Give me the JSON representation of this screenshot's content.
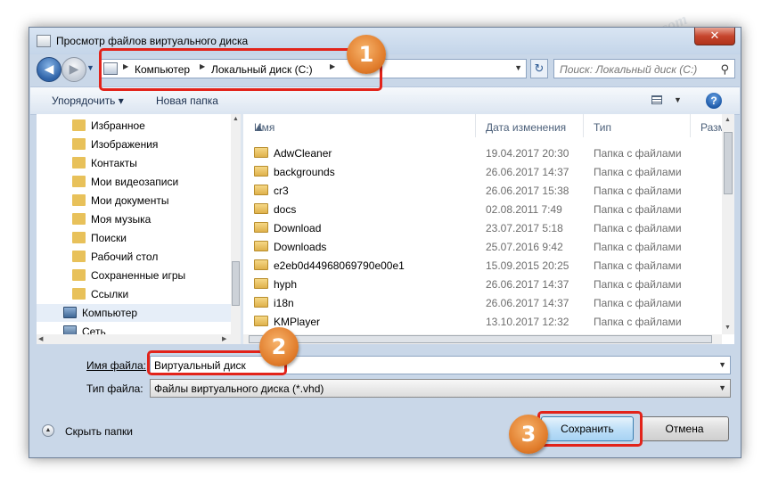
{
  "window": {
    "title": "Просмотр файлов виртуального диска",
    "close_label": "✕"
  },
  "nav": {
    "back_icon": "arrow-left-icon",
    "forward_icon": "arrow-right-icon",
    "breadcrumb": [
      "Компьютер",
      "Локальный диск (C:)"
    ],
    "search_placeholder": "Поиск: Локальный диск (C:)"
  },
  "toolbar": {
    "organize_label": "Упорядочить ▾",
    "new_folder_label": "Новая папка",
    "help_label": "?"
  },
  "sidebar": {
    "items": [
      {
        "label": "Избранное"
      },
      {
        "label": "Изображения"
      },
      {
        "label": "Контакты"
      },
      {
        "label": "Мои видеозаписи"
      },
      {
        "label": "Мои документы"
      },
      {
        "label": "Моя музыка"
      },
      {
        "label": "Поиски"
      },
      {
        "label": "Рабочий стол"
      },
      {
        "label": "Сохраненные игры"
      },
      {
        "label": "Ссылки"
      },
      {
        "label": "Компьютер"
      },
      {
        "label": "Сеть"
      }
    ]
  },
  "files": {
    "columns": [
      "Имя",
      "Дата изменения",
      "Тип",
      "Разм"
    ],
    "rows": [
      {
        "name": "AdwCleaner",
        "date": "19.04.2017 20:30",
        "type": "Папка с файлами"
      },
      {
        "name": "backgrounds",
        "date": "26.06.2017 14:37",
        "type": "Папка с файлами"
      },
      {
        "name": "cr3",
        "date": "26.06.2017 15:38",
        "type": "Папка с файлами"
      },
      {
        "name": "docs",
        "date": "02.08.2011 7:49",
        "type": "Папка с файлами"
      },
      {
        "name": "Download",
        "date": "23.07.2017 5:18",
        "type": "Папка с файлами"
      },
      {
        "name": "Downloads",
        "date": "25.07.2016 9:42",
        "type": "Папка с файлами"
      },
      {
        "name": "e2eb0d44968069790e00e1",
        "date": "15.09.2015 20:25",
        "type": "Папка с файлами"
      },
      {
        "name": "hyph",
        "date": "26.06.2017 14:37",
        "type": "Папка с файлами"
      },
      {
        "name": "i18n",
        "date": "26.06.2017 14:37",
        "type": "Папка с файлами"
      },
      {
        "name": "KMPlayer",
        "date": "13.10.2017 12:32",
        "type": "Папка с файлами"
      }
    ]
  },
  "form": {
    "filename_label": "Имя файла:",
    "filename_value": "Виртуальный диск",
    "filetype_label": "Тип файла:",
    "filetype_value": "Файлы виртуального диска (*.vhd)"
  },
  "footer": {
    "hide_folders_label": "Скрыть папки",
    "save_label": "Сохранить",
    "cancel_label": "Отмена"
  },
  "annotations": {
    "badge1": "1",
    "badge2": "2",
    "badge3": "3",
    "color": "#e2231a",
    "badge_color": "#e07b2a"
  },
  "watermark": "Soringpcrepair.com"
}
